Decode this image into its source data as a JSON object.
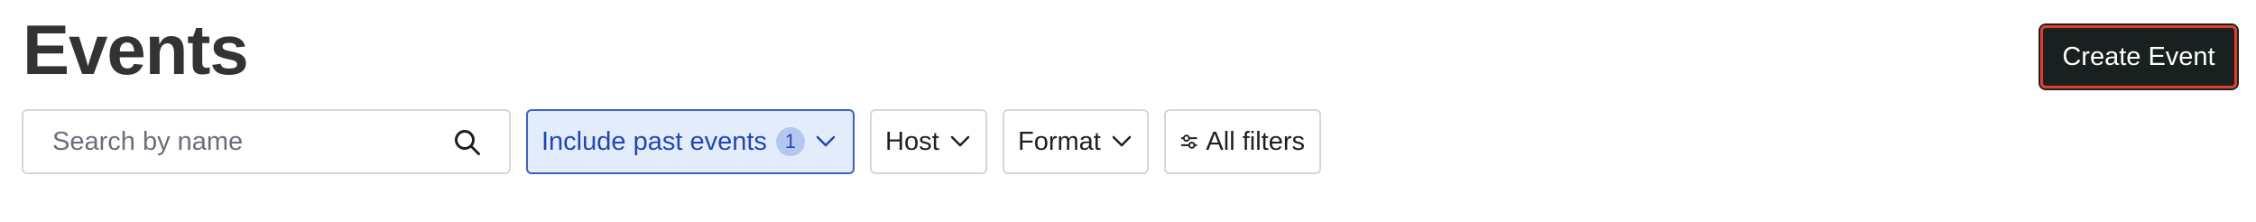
{
  "page": {
    "title": "Events",
    "create_button_label": "Create Event"
  },
  "filters": {
    "search_placeholder": "Search by name",
    "search_value": "",
    "include_past_label": "Include past events",
    "include_past_count": "1",
    "host_label": "Host",
    "format_label": "Format",
    "all_filters_label": "All filters"
  },
  "icons": {
    "search": "search-icon",
    "chevron": "chevron-down-icon",
    "filters": "sliders-icon"
  },
  "colors": {
    "create_button_bg": "#182120",
    "create_button_outline": "#e83c2b",
    "active_chip_bg": "#e2ecfb",
    "active_chip_text": "#2347b3"
  }
}
